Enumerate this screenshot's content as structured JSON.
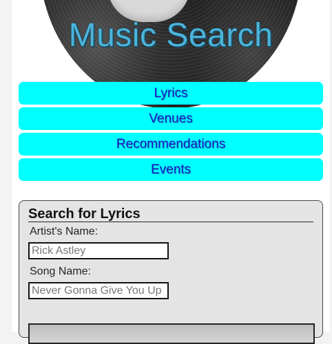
{
  "header": {
    "title": "Music Search"
  },
  "nav": {
    "items": [
      {
        "label": "Lyrics"
      },
      {
        "label": "Venues"
      },
      {
        "label": "Recommendations"
      },
      {
        "label": "Events"
      }
    ]
  },
  "lyrics_form": {
    "title": "Search for Lyrics",
    "artist_label": "Artist's Name:",
    "artist_placeholder": "Rick Astley",
    "song_label": "Song Name:",
    "song_placeholder": "Never Gonna Give You Up"
  },
  "colors": {
    "nav_bg": "#00ffff",
    "nav_text": "#1a1acc",
    "title": "#4ab4dc",
    "form_bg": "#e4e4e4"
  }
}
